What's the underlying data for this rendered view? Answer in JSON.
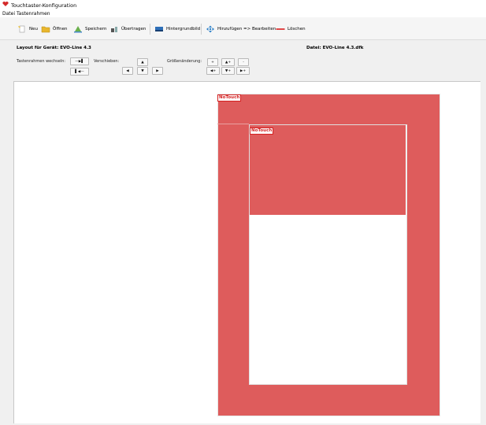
{
  "window": {
    "title": "Touchtaster-Konfiguration"
  },
  "menu": {
    "items": [
      "Datei",
      "Tastenrahmen"
    ]
  },
  "toolbar": {
    "new": "Neu",
    "open": "Öffnen",
    "save": "Speichern",
    "transfer": "Übertragen",
    "background": "Hintergrundbild",
    "add_edit": "Hinzufügen => Bearbeiten",
    "delete": "Löschen"
  },
  "info": {
    "layout_label": "Layout für Gerät: EVO-Line 4.3",
    "file_label": "Datei: EVO-Line 4.3.dfk",
    "switch_label": "Tastenrahmen wechseln:",
    "move_label": "Verschieben:",
    "resize_label": "Größenänderung:"
  },
  "controls": {
    "switch_next": "—▶▌",
    "switch_prev": "▌◀—",
    "up": "▲",
    "left": "◀",
    "down": "▼",
    "right": "▶",
    "grow": "+",
    "up_plus": "▲+",
    "minus": "-",
    "left_plus": "◀+",
    "down_plus": "▼+",
    "right_plus": "▶+"
  },
  "canvas": {
    "outer_label": "NoTouch",
    "inner_label": "NoTouch",
    "frame_color": "#de5c5c"
  }
}
